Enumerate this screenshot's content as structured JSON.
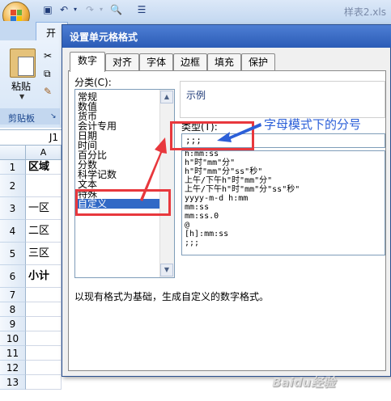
{
  "excel": {
    "doc_title": "样表2.xls",
    "home_tab": "开",
    "paste_label": "粘贴",
    "clipboard_label": "剪贴板",
    "namebox": "J1",
    "column_header": "A",
    "rows": [
      {
        "num": "1",
        "a": "区域"
      },
      {
        "num": "2",
        "a": ""
      },
      {
        "num": "3",
        "a": "一区"
      },
      {
        "num": "4",
        "a": "二区"
      },
      {
        "num": "5",
        "a": "三区"
      },
      {
        "num": "6",
        "a": "小计"
      },
      {
        "num": "7",
        "a": ""
      },
      {
        "num": "8",
        "a": ""
      },
      {
        "num": "9",
        "a": ""
      },
      {
        "num": "10",
        "a": ""
      },
      {
        "num": "11",
        "a": ""
      },
      {
        "num": "12",
        "a": ""
      },
      {
        "num": "13",
        "a": ""
      }
    ]
  },
  "dialog": {
    "title": "设置单元格格式",
    "tabs": [
      "数字",
      "对齐",
      "字体",
      "边框",
      "填充",
      "保护"
    ],
    "active_tab": 0,
    "category_label": "分类(C):",
    "categories": [
      "常规",
      "数值",
      "货币",
      "会计专用",
      "日期",
      "时间",
      "百分比",
      "分数",
      "科学记数",
      "文本",
      "特殊",
      "自定义"
    ],
    "selected_category": 11,
    "sample_label": "示例",
    "type_label": "类型(T):",
    "type_value": ";;;",
    "formats": [
      "h:mm:ss",
      "h\"时\"mm\"分\"",
      "h\"时\"mm\"分\"ss\"秒\"",
      "上午/下午h\"时\"mm\"分\"",
      "上午/下午h\"时\"mm\"分\"ss\"秒\"",
      "yyyy-m-d h:mm",
      "mm:ss",
      "mm:ss.0",
      "@",
      "[h]:mm:ss",
      ";;;"
    ],
    "description": "以现有格式为基础，生成自定义的数字格式。"
  },
  "annotation": {
    "text": "字母模式下的分号",
    "color": "#2b5fd8",
    "box_color": "#e8383d"
  },
  "watermark": "Baidu经验"
}
